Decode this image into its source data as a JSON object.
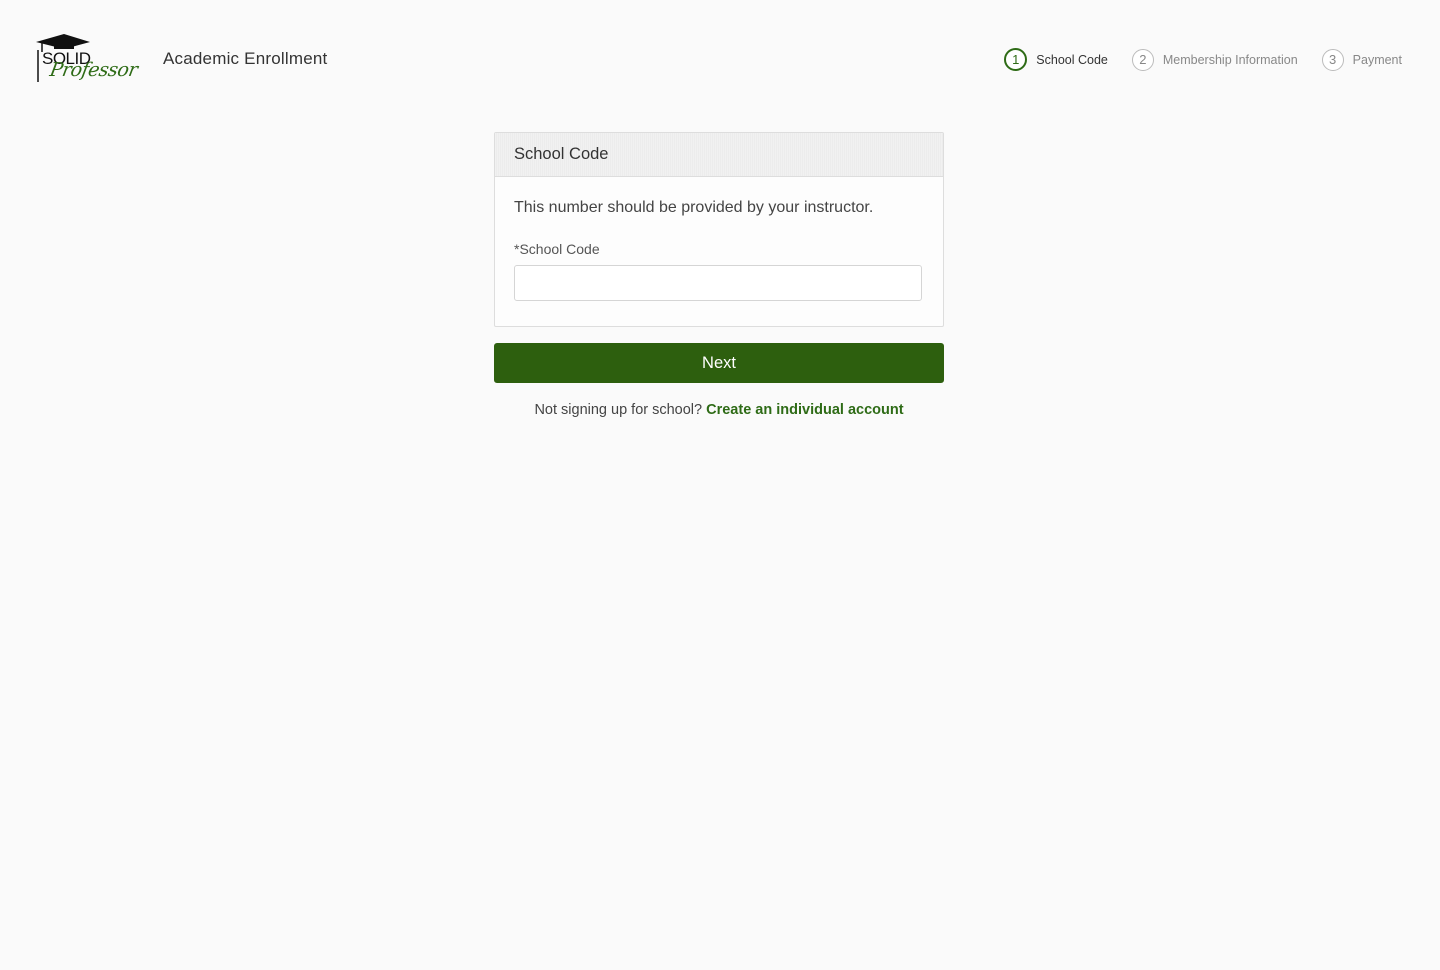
{
  "header": {
    "logo": {
      "text_solid": "SOLID",
      "text_professor": "Professor"
    },
    "title": "Academic Enrollment",
    "steps": [
      {
        "number": "1",
        "label": "School Code",
        "active": true
      },
      {
        "number": "2",
        "label": "Membership Information",
        "active": false
      },
      {
        "number": "3",
        "label": "Payment",
        "active": false
      }
    ]
  },
  "card": {
    "title": "School Code",
    "description": "This number should be provided by your instructor.",
    "field_label": "*School Code",
    "field_value": "",
    "field_placeholder": ""
  },
  "actions": {
    "next_label": "Next"
  },
  "footer": {
    "prompt": "Not signing up for school?",
    "link_label": "Create an individual account"
  },
  "colors": {
    "brand_green": "#2d5f0e",
    "link_green": "#2e6b16"
  },
  "icons": {
    "logo_cap": "graduation-cap-icon"
  }
}
